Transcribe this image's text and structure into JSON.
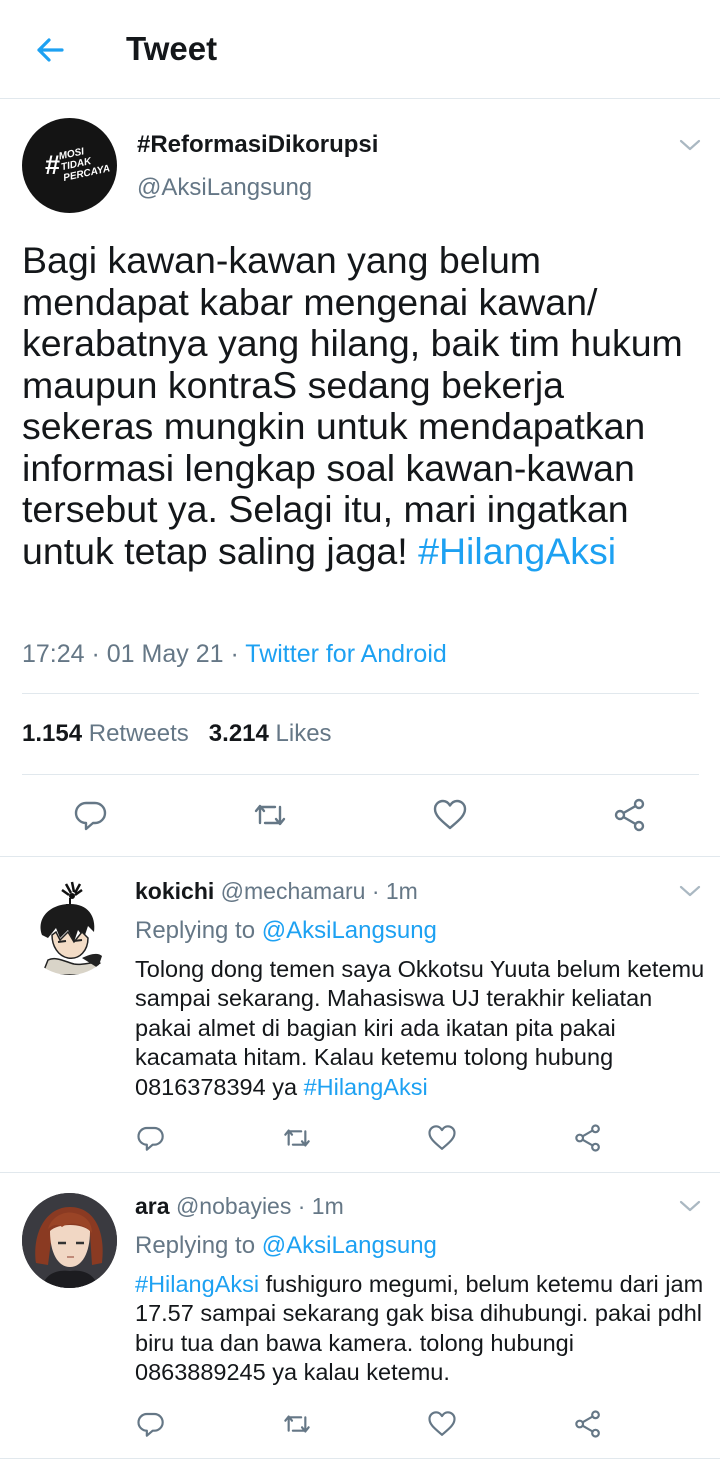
{
  "header": {
    "title": "Tweet",
    "back_icon": "arrow-left-icon"
  },
  "colors": {
    "accent": "#1da1f2",
    "secondary_text": "#657786",
    "divider": "#e1e8ed"
  },
  "tweet": {
    "avatar_text": {
      "hash": "#",
      "line1": "MOSI",
      "line2": "TIDAK",
      "line3": "PERCAYA"
    },
    "name": "#ReformasiDikorupsi",
    "handle": "@AksiLangsung",
    "text": "Bagi kawan-kawan yang belum mendapat kabar mengenai kawan/ kerabatnya yang hilang, baik tim hukum maupun kontraS sedang bekerja sekeras mungkin untuk mendapatkan informasi lengkap soal kawan-kawan tersebut ya. Selagi itu, mari ingatkan untuk tetap saling jaga!",
    "hashtag": "#HilangAksi",
    "time": "17:24",
    "sep1": " · ",
    "date": "01 May 21",
    "sep2": " · ",
    "source": "Twitter for Android",
    "retweets_count": "1.154",
    "retweets_label": "Retweets",
    "likes_count": "3.214",
    "likes_label": "Likes"
  },
  "replies": [
    {
      "name": "kokichi",
      "handle": "@mechamaru",
      "time": "· 1m",
      "replying_label": "Replying to",
      "replying_to": "@AksiLangsung",
      "text_before": "Tolong dong temen saya Okkotsu Yuuta belum ketemu sampai sekarang. Mahasiswa UJ terakhir keliatan pakai almet di bagian kiri ada ikatan pita pakai kacamata hitam. Kalau ketemu tolong hubung 0816378394 ya ",
      "hashtag": "#HilangAksi",
      "text_after": ""
    },
    {
      "name": "ara",
      "handle": "@nobayies",
      "time": "· 1m",
      "replying_label": "Replying to",
      "replying_to": "@AksiLangsung",
      "hashtag": "#HilangAksi",
      "text_after": " fushiguro megumi, belum ketemu dari jam 17.57 sampai sekarang gak bisa dihubungi. pakai pdhl biru tua dan bawa kamera. tolong hubungi 0863889245 ya kalau ketemu."
    }
  ]
}
